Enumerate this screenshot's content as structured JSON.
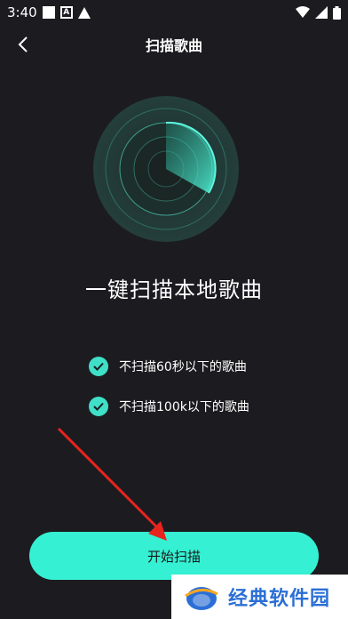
{
  "status": {
    "time": "3:40",
    "a_icon_text": "A"
  },
  "header": {
    "title": "扫描歌曲"
  },
  "main": {
    "heading": "一键扫描本地歌曲",
    "options": [
      {
        "label": "不扫描60秒以下的歌曲"
      },
      {
        "label": "不扫描100k以下的歌曲"
      }
    ],
    "start_label": "开始扫描"
  },
  "watermark": {
    "text": "经典软件园"
  },
  "colors": {
    "accent": "#35f0d2",
    "background": "#1c1c20",
    "annotation_arrow": "#e8241f"
  }
}
